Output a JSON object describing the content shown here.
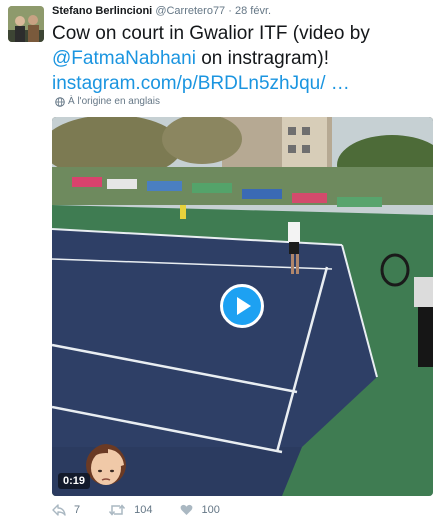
{
  "user": {
    "name": "Stefano Berlincioni",
    "handle": "@Carretero77",
    "separator": "·",
    "date": "28 févr."
  },
  "tweet": {
    "text_start": "Cow on court in Gwalior ITF (video by ",
    "mention": "@FatmaNabhani",
    "text_end": " on instragram)! ",
    "link": "instagram.com/p/BRDLn5zhJqu/ …",
    "translation_note": "À l'origine en anglais"
  },
  "media": {
    "type": "video",
    "duration": "0:19",
    "play_icon": "play-icon"
  },
  "actions": {
    "reply_count": "7",
    "retweet_count": "104",
    "like_count": "100"
  },
  "colors": {
    "link": "#1b95e0",
    "play_button": "#1da1f2",
    "secondary_text": "#657786",
    "court": "#2e3f66"
  }
}
